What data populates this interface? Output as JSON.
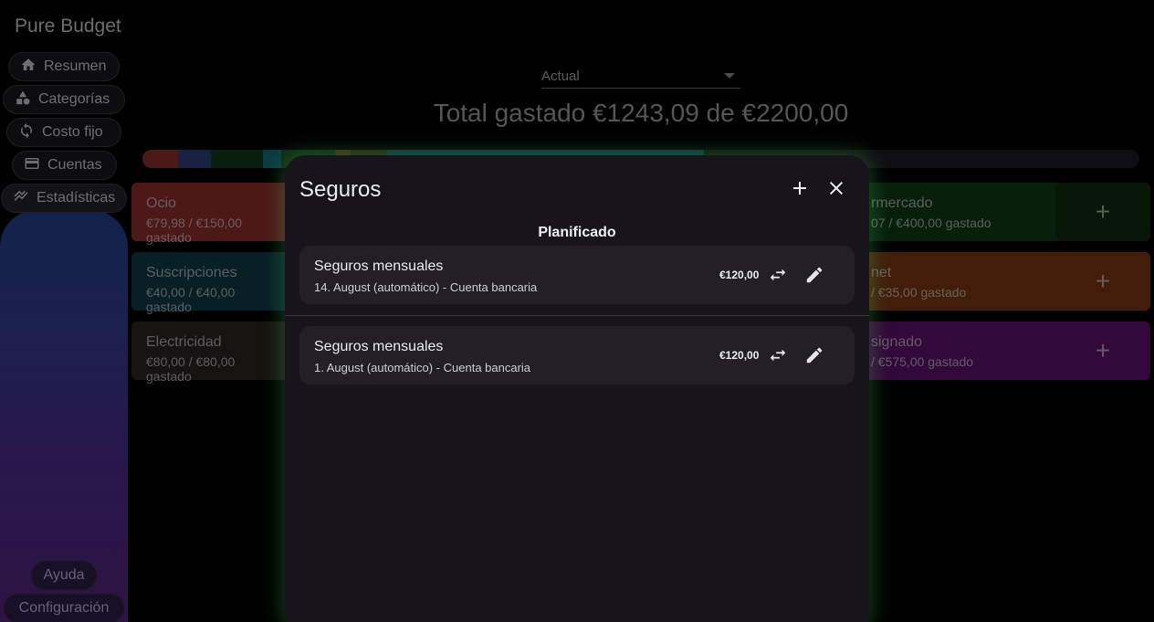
{
  "app": {
    "title": "Pure Budget"
  },
  "nav": [
    {
      "label": "Resumen",
      "icon": "home-icon"
    },
    {
      "label": "Categorías",
      "icon": "shapes-icon"
    },
    {
      "label": "Costo fijo",
      "icon": "refresh-icon"
    },
    {
      "label": "Cuentas",
      "icon": "card-icon"
    },
    {
      "label": "Estadísticas",
      "icon": "chart-icon"
    }
  ],
  "bottom_nav": {
    "help": "Ayuda",
    "settings": "Configuración"
  },
  "period_select": {
    "value": "Actual"
  },
  "summary": {
    "total_text": "Total gastado €1243,09 de €2200,00"
  },
  "progress": {
    "segments": [
      {
        "fraction": 0.036,
        "color": "#8b2f2f"
      },
      {
        "fraction": 0.033,
        "color": "#2d3d78"
      },
      {
        "fraction": 0.052,
        "color": "#12391a"
      },
      {
        "fraction": 0.018,
        "color": "#146a7a"
      },
      {
        "fraction": 0.054,
        "color": "#1a4a20"
      },
      {
        "fraction": 0.016,
        "color": "#6a4a20"
      },
      {
        "fraction": 0.036,
        "color": "#3f3f22"
      },
      {
        "fraction": 0.318,
        "color": "#145a62"
      }
    ]
  },
  "categories_left": [
    {
      "name": "Ocio",
      "amount": "€79,98 / €150,00 gastado",
      "color": "#8c2c2c"
    },
    {
      "name": "Suscripciones",
      "amount": "€40,00 / €40,00 gastado",
      "color": "#0f3a45"
    },
    {
      "name": "Electricidad",
      "amount": "€80,00 / €80,00 gastado",
      "color": "#2b2322"
    }
  ],
  "categories_right": [
    {
      "name": "rmercado",
      "amount": "07 / €400,00 gastado",
      "color": "#103a14"
    },
    {
      "name": "net",
      "amount": "/ €35,00 gastado",
      "color": "#7a3512"
    },
    {
      "name": "signado",
      "amount": "/ €575,00 gastado",
      "color": "#5d0f6a"
    }
  ],
  "dialog": {
    "title": "Seguros",
    "section": "Planificado",
    "items": [
      {
        "title": "Seguros mensuales",
        "subtitle": "14. August (automático) - Cuenta bancaria",
        "price": "€120,00"
      },
      {
        "title": "Seguros mensuales",
        "subtitle": "1. August (automático) - Cuenta bancaria",
        "price": "€120,00"
      }
    ]
  },
  "icons": {
    "add": "plus-icon",
    "close": "close-icon",
    "transfer": "swap-icon",
    "edit": "pencil-icon"
  }
}
